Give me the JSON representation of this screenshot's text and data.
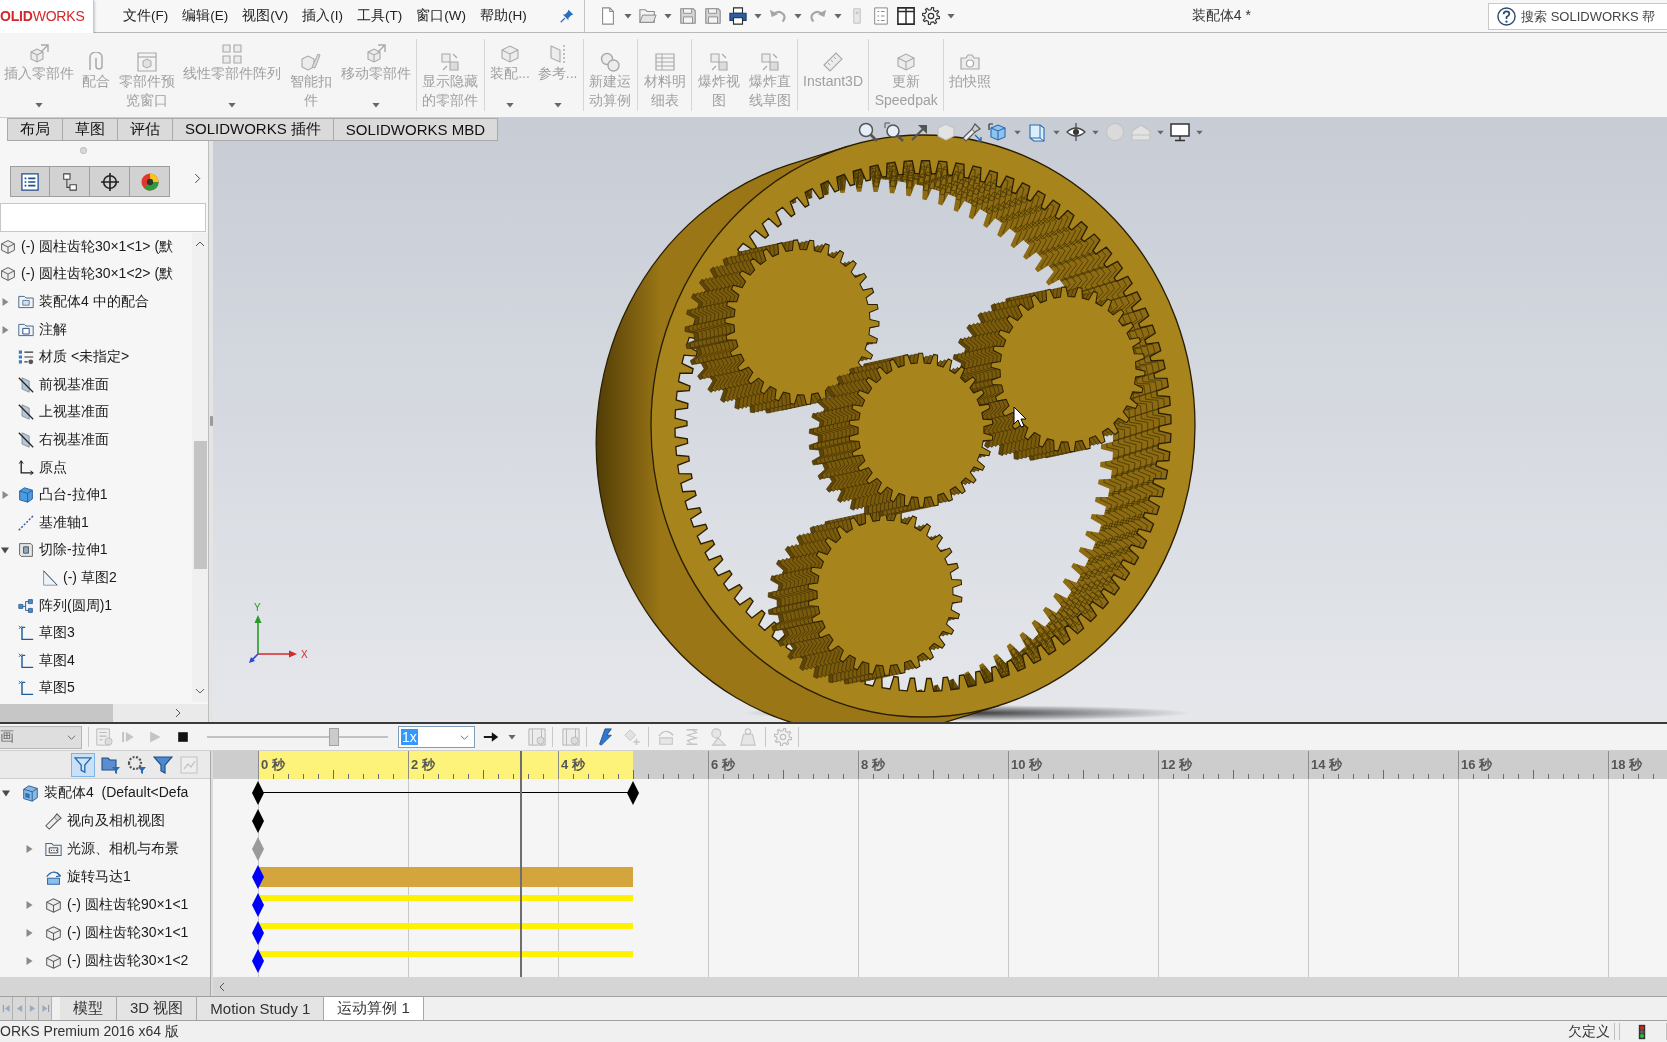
{
  "title_bar": {
    "logo": "**OLID**WORKS",
    "menu": [
      "文件(F)",
      "编辑(E)",
      "视图(V)",
      "插入(I)",
      "工具(T)",
      "窗口(W)",
      "帮助(H)"
    ],
    "document_title": "装配体4 *",
    "search": {
      "placeholder": "搜索 SOLIDWORKS 帮"
    }
  },
  "command_manager": {
    "groups": [
      [
        {
          "label": "插入零部件",
          "caret": true,
          "disabled": true
        },
        {
          "label": "配合",
          "caret": false,
          "disabled": true
        },
        {
          "label": "零部件预览窗口",
          "caret": false,
          "disabled": true
        },
        {
          "label": "线性零部件阵列",
          "caret": true,
          "disabled": true
        },
        {
          "label": "智能扣件",
          "caret": false,
          "disabled": true
        },
        {
          "label": "移动零部件",
          "caret": true,
          "disabled": true
        }
      ],
      [
        {
          "label": "显示隐藏的零部件",
          "caret": false,
          "disabled": true
        }
      ],
      [
        {
          "label": "装配...",
          "caret": true,
          "disabled": true
        },
        {
          "label": "参考...",
          "caret": true,
          "disabled": true
        }
      ],
      [
        {
          "label": "新建运动算例",
          "caret": false,
          "disabled": true
        }
      ],
      [
        {
          "label": "材料明细表",
          "caret": false,
          "disabled": true
        }
      ],
      [
        {
          "label": "爆炸视图",
          "caret": false,
          "disabled": true
        },
        {
          "label": "爆炸直线草图",
          "caret": false,
          "disabled": true
        }
      ],
      [
        {
          "label": "Instant3D",
          "caret": false,
          "disabled": true
        }
      ],
      [
        {
          "label": "更新 Speedpak",
          "caret": false,
          "disabled": true
        }
      ],
      [
        {
          "label": "拍快照",
          "caret": false,
          "disabled": true
        }
      ]
    ]
  },
  "command_tabs": [
    {
      "label": "布局",
      "selected": false
    },
    {
      "label": "草图",
      "selected": false
    },
    {
      "label": "评估",
      "selected": false
    },
    {
      "label": "SOLIDWORKS 插件",
      "selected": false
    },
    {
      "label": "SOLIDWORKS MBD",
      "selected": false
    }
  ],
  "feature_manager": {
    "tabs": [
      {
        "selected": false
      },
      {
        "selected": false
      },
      {
        "selected": false
      },
      {
        "selected": false
      }
    ],
    "tree": [
      {
        "label": "(-) 圆柱齿轮30×1<1> (默",
        "kind": "component"
      },
      {
        "label": "(-) 圆柱齿轮30×1<2> (默",
        "kind": "component"
      },
      {
        "label": "装配体4 中的配合",
        "kind": "mates",
        "expanded": false
      },
      {
        "label": "注解",
        "kind": "annotations",
        "expanded": false
      },
      {
        "label": "材质 <未指定>",
        "kind": "material"
      },
      {
        "label": "前视基准面",
        "kind": "plane"
      },
      {
        "label": "上视基准面",
        "kind": "plane"
      },
      {
        "label": "右视基准面",
        "kind": "plane"
      },
      {
        "label": "原点",
        "kind": "origin"
      },
      {
        "label": "凸台-拉伸1",
        "kind": "extrude",
        "expanded": false
      },
      {
        "label": "基准轴1",
        "kind": "axis"
      },
      {
        "label": "切除-拉伸1",
        "kind": "cut",
        "expanded": true,
        "children": [
          {
            "label": "(-) 草图2",
            "kind": "sketch"
          }
        ]
      },
      {
        "label": "阵列(圆周)1",
        "kind": "pattern"
      },
      {
        "label": "草图3",
        "kind": "pathsketch"
      },
      {
        "label": "草图4",
        "kind": "pathsketch"
      },
      {
        "label": "草图5",
        "kind": "pathsketch"
      }
    ]
  },
  "viewport": {
    "triad": {
      "y_label": "Y",
      "x_label": "X"
    }
  },
  "motion_study": {
    "study_type": "画",
    "speed": "1x",
    "playback": {
      "level": 0.7
    },
    "ruler": [
      "0 秒",
      "2 秒",
      "4 秒",
      "6 秒",
      "8 秒",
      "10 秒",
      "12 秒",
      "14 秒",
      "16 秒",
      "18 秒"
    ],
    "tree": [
      {
        "label": "装配体4  (Default<Defa",
        "kind": "assembly",
        "expanded": true,
        "color": "#000000",
        "children": [
          {
            "label": "视向及相机视图",
            "kind": "camera",
            "color": "#000000"
          },
          {
            "label": "光源、相机与布景",
            "kind": "scene",
            "expanded": false,
            "color": "#9a9a9a"
          },
          {
            "label": "旋转马达1",
            "kind": "motor",
            "color": "#0000ff"
          },
          {
            "label": "(-) 圆柱齿轮90×1<1",
            "kind": "component",
            "expanded": false,
            "color": "#0000ff"
          },
          {
            "label": "(-) 圆柱齿轮30×1<1",
            "kind": "component",
            "expanded": false,
            "color": "#0000ff"
          },
          {
            "label": "(-) 圆柱齿轮30×1<2",
            "kind": "component",
            "expanded": false,
            "color": "#0000ff"
          }
        ]
      }
    ]
  },
  "bottom_tabs": [
    {
      "label": "模型",
      "selected": false
    },
    {
      "label": "3D 视图",
      "selected": false
    },
    {
      "label": "Motion Study 1",
      "selected": false
    },
    {
      "label": "运动算例 1",
      "selected": true
    }
  ],
  "status_bar": {
    "product": "ORKS Premium 2016 x64 版",
    "state": "欠定义"
  }
}
